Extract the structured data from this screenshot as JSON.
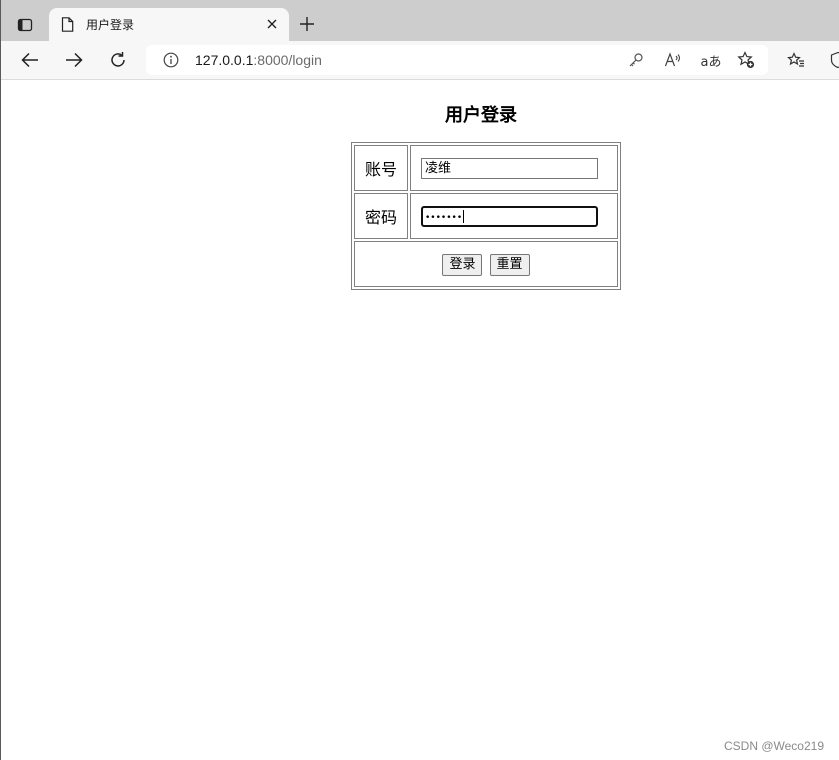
{
  "browser": {
    "tab": {
      "title": "用户登录",
      "close_glyph": "✕",
      "favicon": "page-icon"
    },
    "new_tab_glyph": "+",
    "toolbar": {
      "back_icon": "back-arrow-icon",
      "forward_icon": "forward-arrow-icon",
      "refresh_icon": "refresh-icon"
    },
    "address": {
      "host": "127.0.0.1",
      "rest": ":8000/login",
      "read_aloud_glyph": "À",
      "translate_glyph": "aあ"
    }
  },
  "page": {
    "heading": "用户登录",
    "form": {
      "account_label": "账号",
      "account_value": "凌维",
      "password_label": "密码",
      "password_mask": "•••••••",
      "login_button": "登录",
      "reset_button": "重置"
    }
  },
  "watermark": "CSDN @Weco219"
}
